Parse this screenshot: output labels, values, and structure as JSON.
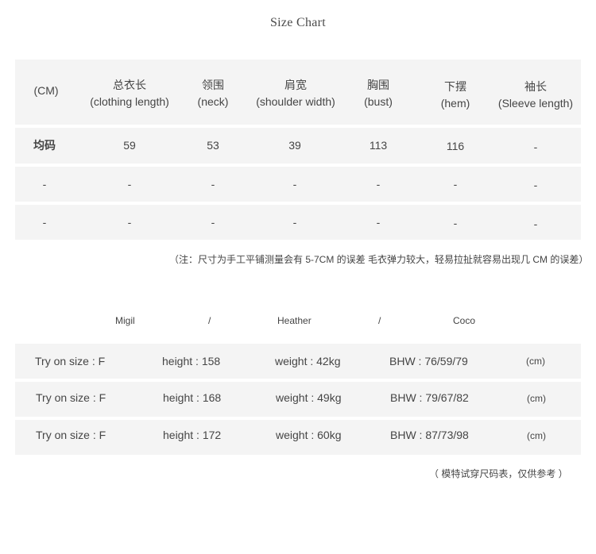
{
  "title": "Size Chart",
  "size_table": {
    "headers": [
      {
        "zh": "",
        "en": "(CM)"
      },
      {
        "zh": "总衣长",
        "en": "(clothing length)"
      },
      {
        "zh": "领围",
        "en": "(neck)"
      },
      {
        "zh": "肩宽",
        "en": "(shoulder width)"
      },
      {
        "zh": "胸围",
        "en": "(bust)"
      },
      {
        "zh": "下摆",
        "en": "(hem)"
      },
      {
        "zh": "袖长",
        "en": "(Sleeve length)"
      }
    ],
    "rows": [
      [
        "均码",
        "59",
        "53",
        "39",
        "113",
        "116",
        "-"
      ],
      [
        "-",
        "-",
        "-",
        "-",
        "-",
        "-",
        "-"
      ],
      [
        "-",
        "-",
        "-",
        "-",
        "-",
        "-",
        "-"
      ]
    ],
    "note": "（注：尺寸为手工平铺测量会有 5-7CM 的误差  毛衣弹力较大，轻易拉扯就容易出现几 CM 的误差）"
  },
  "models": {
    "names": [
      "Migil",
      "/",
      "Heather",
      "/",
      "Coco"
    ],
    "rows": [
      {
        "size": "Try on size : F",
        "height": "height : 158",
        "weight": "weight : 42kg",
        "bhw": "BHW : 76/59/79",
        "unit": "(cm)"
      },
      {
        "size": "Try on size : F",
        "height": "height : 168",
        "weight": "weight : 49kg",
        "bhw": "BHW : 79/67/82",
        "unit": "(cm)"
      },
      {
        "size": "Try on size : F",
        "height": "height : 172",
        "weight": "weight : 60kg",
        "bhw": "BHW : 87/73/98",
        "unit": "(cm)"
      }
    ],
    "note": "（ 模特试穿尺码表，仅供参考 ）"
  }
}
